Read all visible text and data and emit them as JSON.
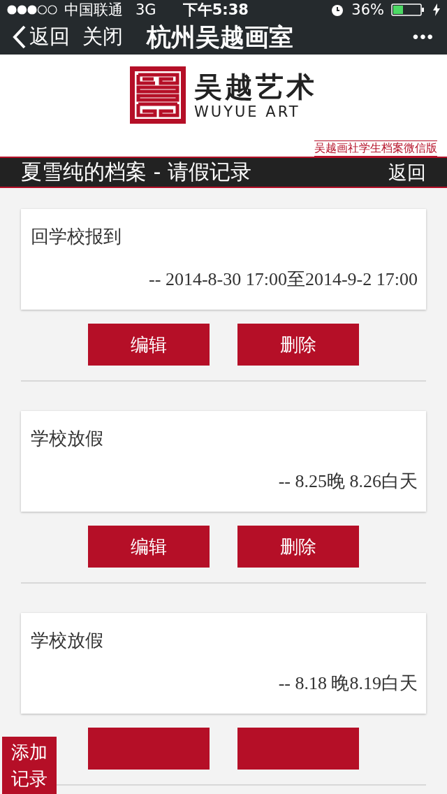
{
  "status_bar": {
    "carrier": "中国联通",
    "network": "3G",
    "time": "下午5:38",
    "battery": "36%"
  },
  "nav": {
    "back": "返回",
    "close": "关闭",
    "title": "杭州吴越画室",
    "more": "•••"
  },
  "logo": {
    "name": "吴越艺术",
    "latin": "WUYUE ART",
    "subtitle": "吴越画社学生档案微信版"
  },
  "header": {
    "title": "夏雪纯的档案 - 请假记录",
    "back": "返回"
  },
  "records": [
    {
      "reason": "回学校报到",
      "period": "-- 2014-8-30 17:00至2014-9-2 17:00",
      "actions": [
        {
          "kind": "labeled",
          "label": "编辑"
        },
        {
          "kind": "labeled",
          "label": "删除"
        }
      ]
    },
    {
      "reason": "学校放假",
      "period": "-- 8.25晚 8.26白天",
      "actions": [
        {
          "kind": "labeled",
          "label": "编辑"
        },
        {
          "kind": "labeled",
          "label": "删除"
        }
      ]
    },
    {
      "reason": "学校放假",
      "period": "-- 8.18 晚8.19白天",
      "actions": [
        {
          "kind": "cut"
        },
        {
          "kind": "cut"
        }
      ]
    }
  ],
  "add_button": {
    "line_1": "添加",
    "line_2": "记录"
  }
}
